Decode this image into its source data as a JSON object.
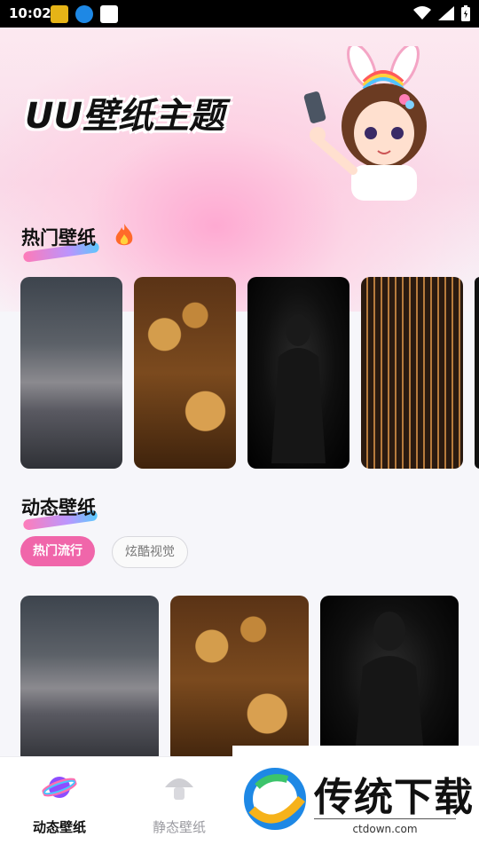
{
  "status_bar": {
    "time": "10:02",
    "icons": [
      "wifi-icon",
      "signal-icon",
      "battery-icon"
    ]
  },
  "hero": {
    "title": "UU壁纸主题"
  },
  "hot_section": {
    "title": "热门壁纸",
    "icon": "fire-icon",
    "thumbnails": [
      "storm-sky",
      "steampunk-gears",
      "shadow-woman",
      "circuit-board",
      "partial"
    ]
  },
  "dynamic_section": {
    "title": "动态壁纸",
    "tabs": [
      {
        "label": "热门流行",
        "active": true
      },
      {
        "label": "炫酷视觉",
        "active": false
      }
    ],
    "cards": [
      "storm-sky",
      "steampunk-gears",
      "shadow-woman"
    ]
  },
  "bottom_nav": {
    "items": [
      {
        "label": "动态壁纸",
        "active": true,
        "icon": "planet-icon"
      },
      {
        "label": "静态壁纸",
        "active": false,
        "icon": "mushroom-icon"
      }
    ]
  },
  "watermark": {
    "title": "传统下载",
    "url": "ctdown.com"
  },
  "colors": {
    "accent": "#f066aa",
    "text": "#111111",
    "muted": "#8a8a8a"
  }
}
